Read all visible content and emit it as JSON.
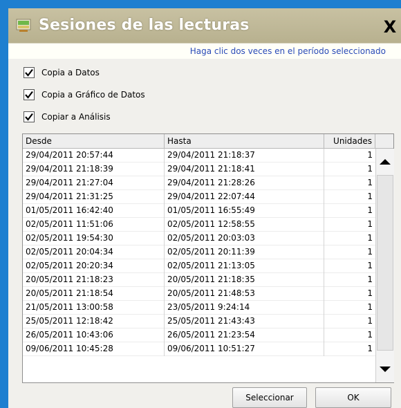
{
  "window": {
    "title": "Sesiones de las lecturas",
    "close_label": "X",
    "hint": "Haga clic dos veces en el período seleccionado"
  },
  "options": [
    {
      "label": "Copia a Datos",
      "checked": true
    },
    {
      "label": "Copia a Gráfico de Datos",
      "checked": true
    },
    {
      "label": "Copiar a Análisis",
      "checked": true
    }
  ],
  "table": {
    "columns": [
      "Desde",
      "Hasta",
      "Unidades"
    ],
    "rows": [
      [
        "29/04/2011 20:57:44",
        "29/04/2011 21:18:37",
        "1"
      ],
      [
        "29/04/2011 21:18:39",
        "29/04/2011 21:18:41",
        "1"
      ],
      [
        "29/04/2011 21:27:04",
        "29/04/2011 21:28:26",
        "1"
      ],
      [
        "29/04/2011 21:31:25",
        "29/04/2011 22:07:44",
        "1"
      ],
      [
        "01/05/2011 16:42:40",
        "01/05/2011 16:55:49",
        "1"
      ],
      [
        "02/05/2011 11:51:06",
        "02/05/2011 12:58:55",
        "1"
      ],
      [
        "02/05/2011 19:54:30",
        "02/05/2011 20:03:03",
        "1"
      ],
      [
        "02/05/2011 20:04:34",
        "02/05/2011 20:11:39",
        "1"
      ],
      [
        "02/05/2011 20:20:34",
        "02/05/2011 21:13:05",
        "1"
      ],
      [
        "20/05/2011 21:18:23",
        "20/05/2011 21:18:35",
        "1"
      ],
      [
        "20/05/2011 21:18:54",
        "20/05/2011 21:48:53",
        "1"
      ],
      [
        "21/05/2011 13:00:58",
        "23/05/2011 9:24:14",
        "1"
      ],
      [
        "25/05/2011 12:18:42",
        "25/05/2011 21:43:43",
        "1"
      ],
      [
        "26/05/2011 10:43:06",
        "26/05/2011 21:23:54",
        "1"
      ],
      [
        "09/06/2011 10:45:28",
        "09/06/2011 10:51:27",
        "1"
      ]
    ]
  },
  "buttons": {
    "select_label": "Seleccionar",
    "ok_label": "OK"
  },
  "colors": {
    "frame": "#1e7fd0",
    "titlebar": "#bcb594",
    "hint_text": "#2a4bb8"
  }
}
